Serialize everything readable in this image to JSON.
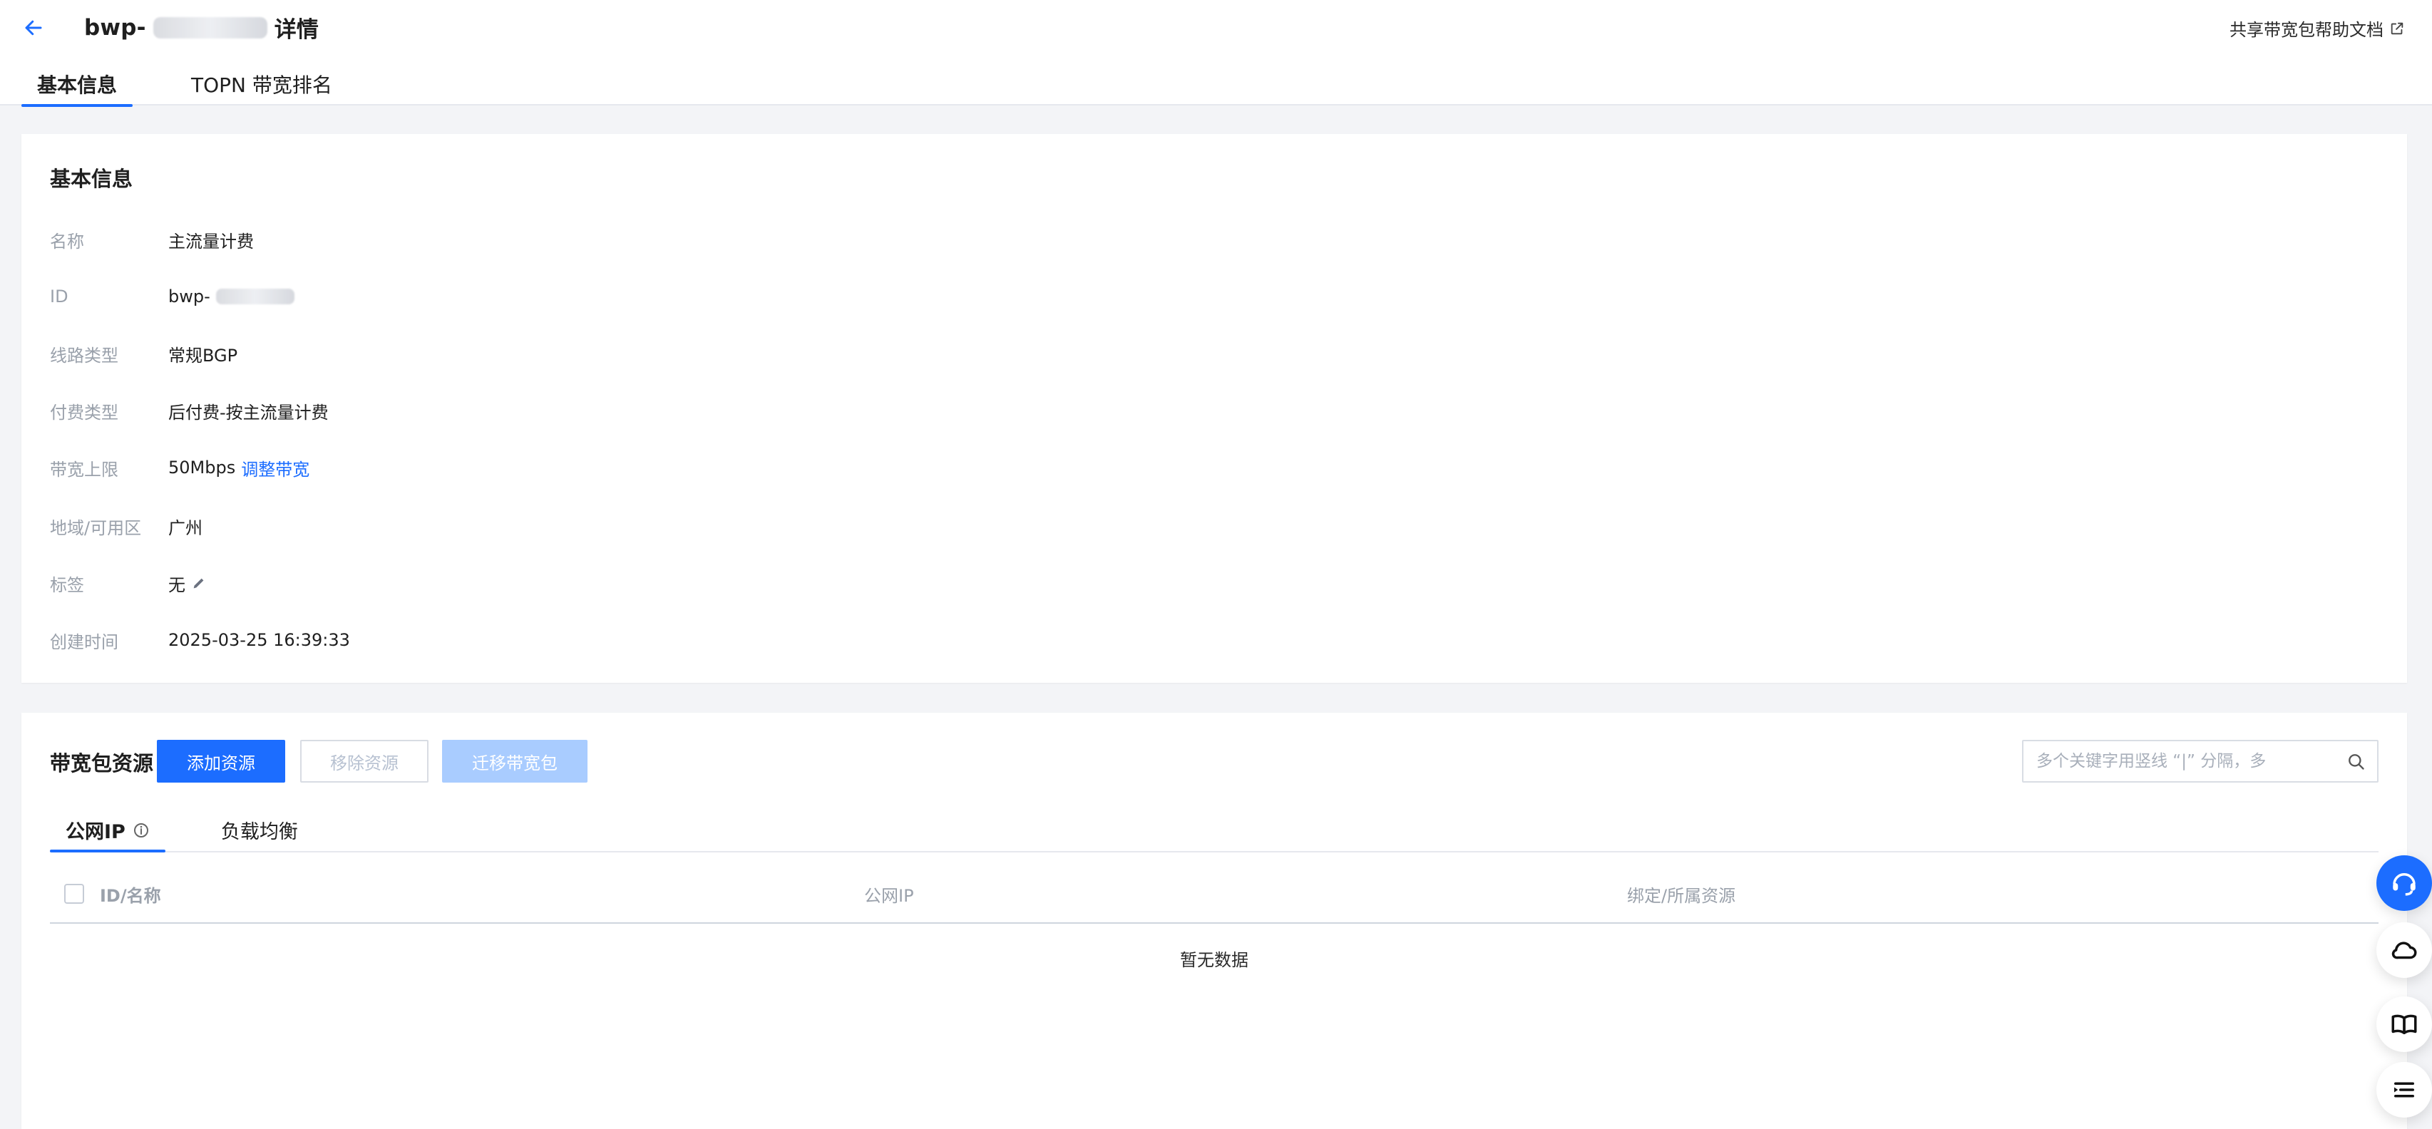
{
  "header": {
    "title_prefix": "bwp-",
    "title_suffix": "详情",
    "help_link": "共享带宽包帮助文档"
  },
  "tabs": [
    {
      "label": "基本信息",
      "active": true
    },
    {
      "label": "TOPN 带宽排名",
      "active": false
    }
  ],
  "basic_info": {
    "title": "基本信息",
    "rows": [
      {
        "label": "名称",
        "value": "主流量计费"
      },
      {
        "label": "ID",
        "value": "bwp-"
      },
      {
        "label": "线路类型",
        "value": "常规BGP"
      },
      {
        "label": "付费类型",
        "value": "后付费-按主流量计费"
      },
      {
        "label": "带宽上限",
        "value": "50Mbps",
        "link": "调整带宽"
      },
      {
        "label": "地域/可用区",
        "value": "广州"
      },
      {
        "label": "标签",
        "value": "无"
      },
      {
        "label": "创建时间",
        "value": "2025-03-25 16:39:33"
      }
    ]
  },
  "resource": {
    "title": "带宽包资源",
    "buttons": {
      "add": "添加资源",
      "remove": "移除资源",
      "migrate": "迁移带宽包"
    },
    "search_placeholder": "多个关键字用竖线 “|” 分隔，多",
    "subtabs": [
      {
        "label": "公网IP",
        "active": true
      },
      {
        "label": "负载均衡",
        "active": false
      }
    ],
    "table": {
      "columns": [
        "ID/名称",
        "公网IP",
        "绑定/所属资源"
      ],
      "empty_text": "暂无数据"
    }
  },
  "colors": {
    "accent": "#1c6dff",
    "muted": "#9aa1ab",
    "background": "#f3f4f7"
  },
  "icons": {
    "back": "arrow-left-icon",
    "external": "external-link-icon",
    "edit": "pencil-icon",
    "info": "info-circle-icon",
    "search": "search-icon",
    "support": "headset-icon",
    "cloud": "cloud-icon",
    "book": "book-icon",
    "list": "list-icon"
  }
}
